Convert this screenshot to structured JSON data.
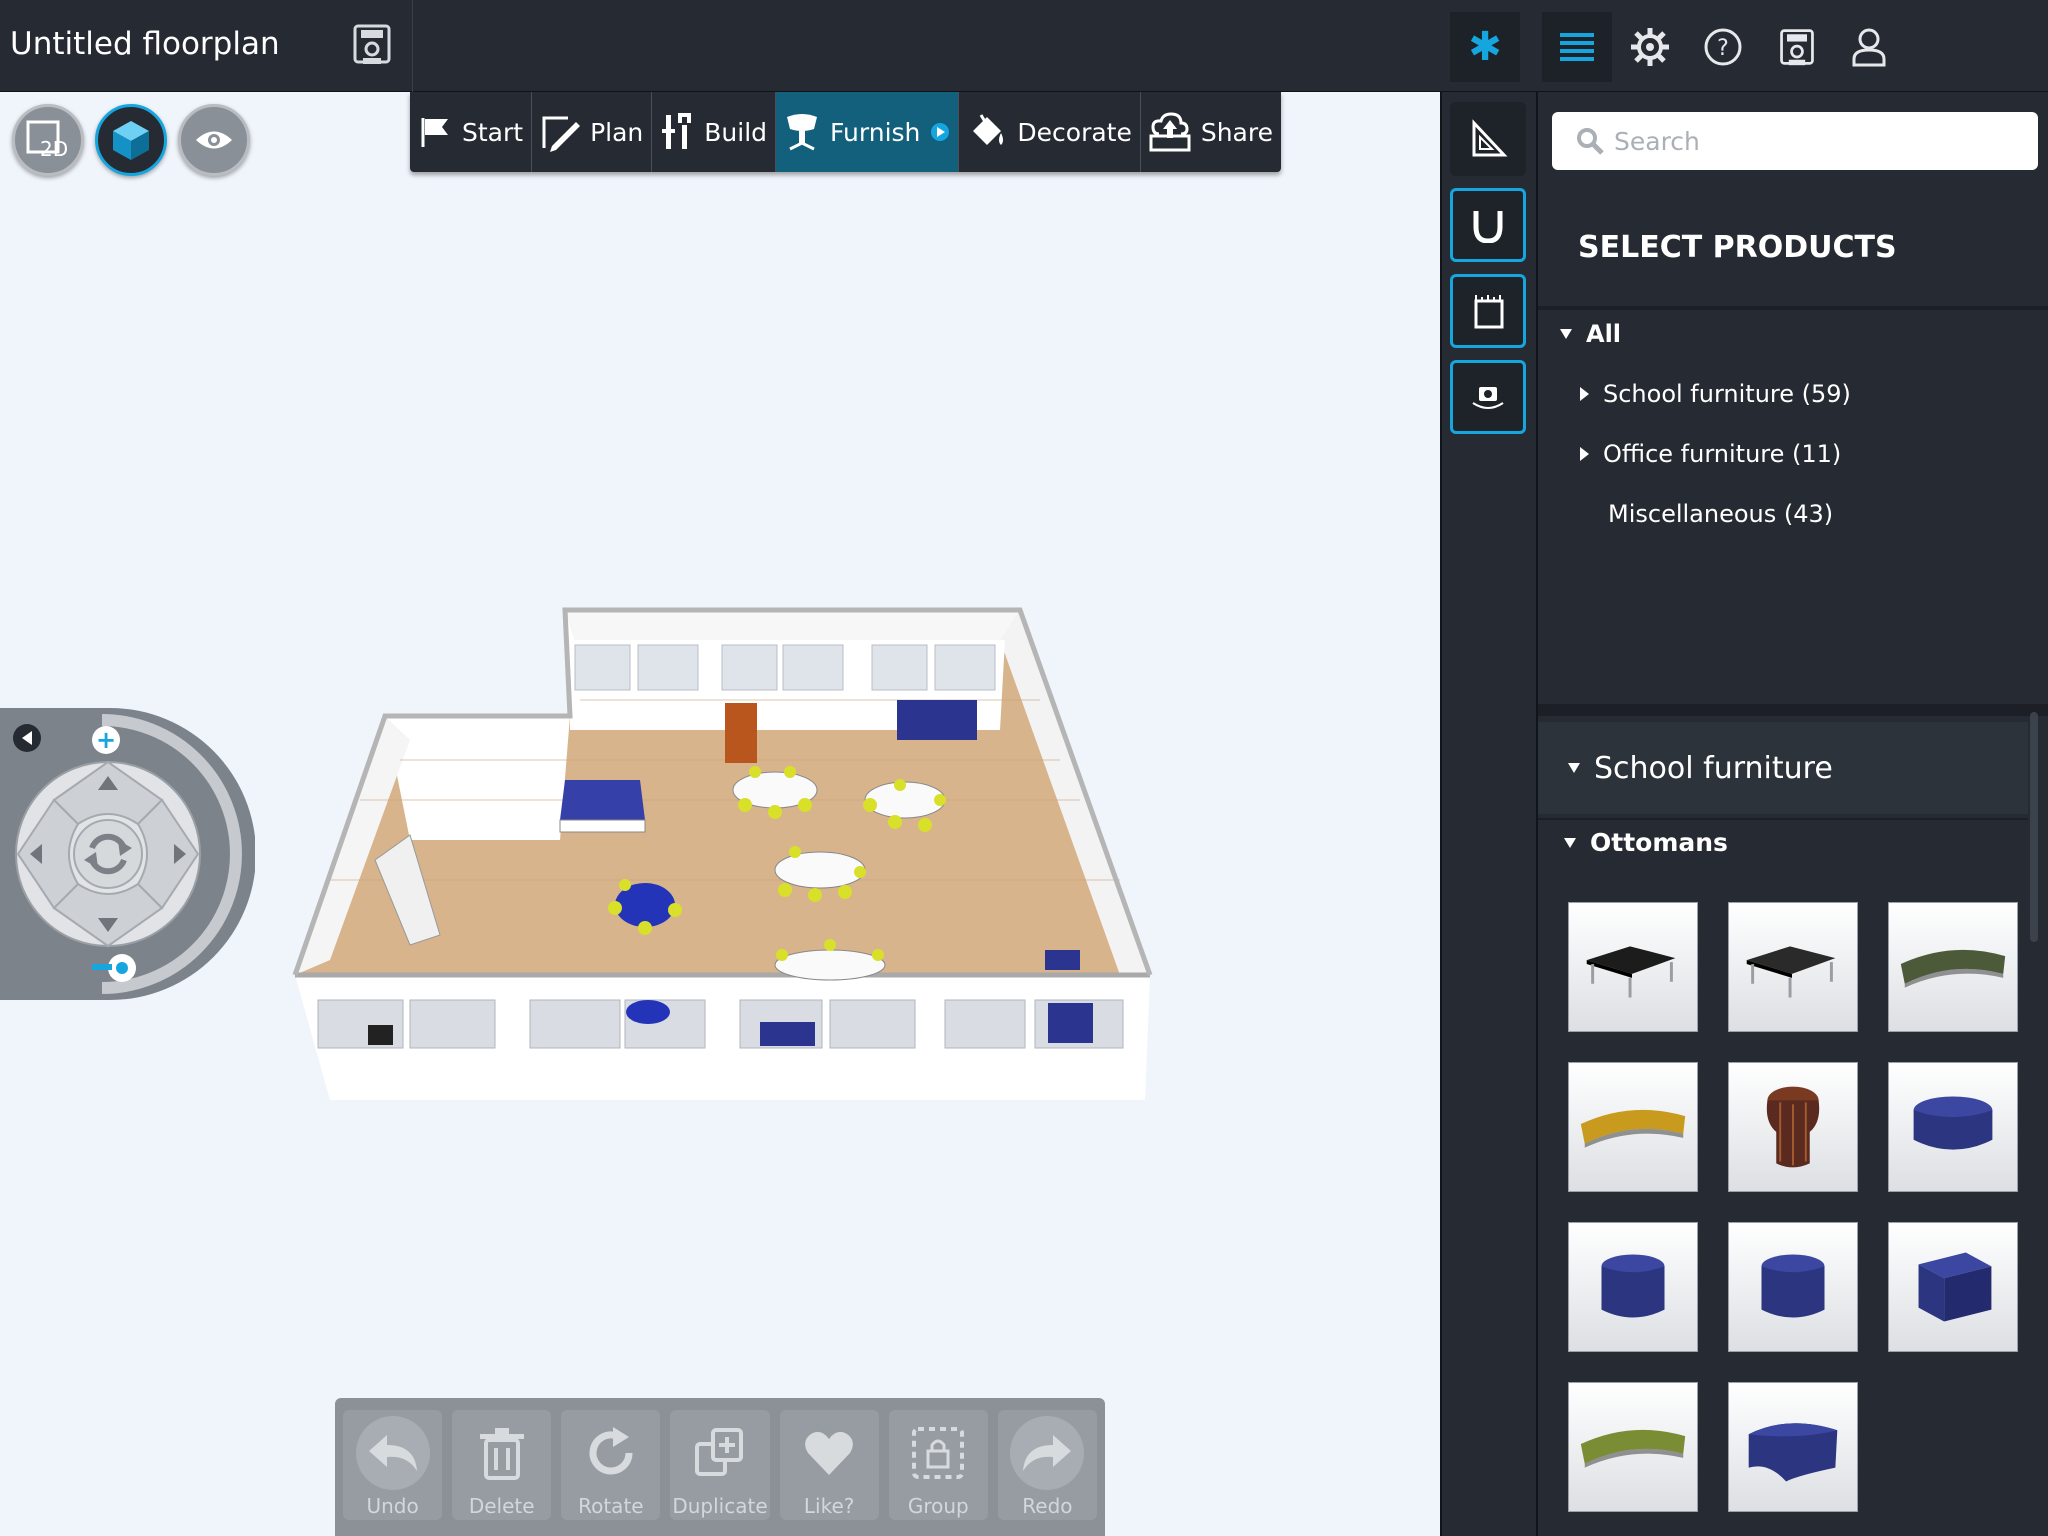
{
  "app": {
    "title": "Untitled floorplan"
  },
  "steps": [
    {
      "label": "Start",
      "icon": "flag-icon",
      "active": false
    },
    {
      "label": "Plan",
      "icon": "pencil-icon",
      "active": false
    },
    {
      "label": "Build",
      "icon": "tools-icon",
      "active": false
    },
    {
      "label": "Furnish",
      "icon": "chair-icon",
      "active": true
    },
    {
      "label": "Decorate",
      "icon": "paint-bucket-icon",
      "active": false
    },
    {
      "label": "Share",
      "icon": "cloud-upload-icon",
      "active": false
    }
  ],
  "view_modes": [
    {
      "label": "2D",
      "icon": "2d-view-icon"
    },
    {
      "label": "3D",
      "icon": "3d-cube-icon",
      "active": true
    },
    {
      "label": "",
      "icon": "eye-icon"
    }
  ],
  "toolbar": {
    "undo": "Undo",
    "delete": "Delete",
    "rotate": "Rotate",
    "duplicate": "Duplicate",
    "like": "Like?",
    "group": "Group",
    "redo": "Redo"
  },
  "search": {
    "placeholder": "Search"
  },
  "panel": {
    "heading": "SELECT PRODUCTS",
    "tree": {
      "all": "All",
      "school": "School furniture (59)",
      "office": "Office furniture (11)",
      "misc": "Miscellaneous (43)"
    },
    "section": "School furniture",
    "subsection": "Ottomans",
    "products": [
      {
        "name": "black square ottoman table",
        "color": "#1c1c1c",
        "shape": "table"
      },
      {
        "name": "black tapered ottoman table",
        "color": "#2a2a2a",
        "shape": "table"
      },
      {
        "name": "green curved bench",
        "color": "#4d5a3a",
        "shape": "bench"
      },
      {
        "name": "yellow curved bench",
        "color": "#c89a1e",
        "shape": "bench"
      },
      {
        "name": "striped mushroom stool",
        "color": "#5a2a20",
        "shape": "mushroom"
      },
      {
        "name": "blue round pouf",
        "color": "#2b3580",
        "shape": "pouf"
      },
      {
        "name": "blue cylinder ottoman",
        "color": "#2b3580",
        "shape": "cylinder"
      },
      {
        "name": "blue tall cylinder ottoman",
        "color": "#2b3580",
        "shape": "cylinder"
      },
      {
        "name": "blue cube ottoman",
        "color": "#2b3580",
        "shape": "cube"
      },
      {
        "name": "green wave bench",
        "color": "#7a8c34",
        "shape": "bench"
      },
      {
        "name": "blue wedge ottoman",
        "color": "#2b3580",
        "shape": "wedge"
      }
    ]
  },
  "colors": {
    "accent": "#15a6e0",
    "dark": "#262b33",
    "active_tab": "#13607c",
    "canvas_bg": "#f0f4fb"
  }
}
